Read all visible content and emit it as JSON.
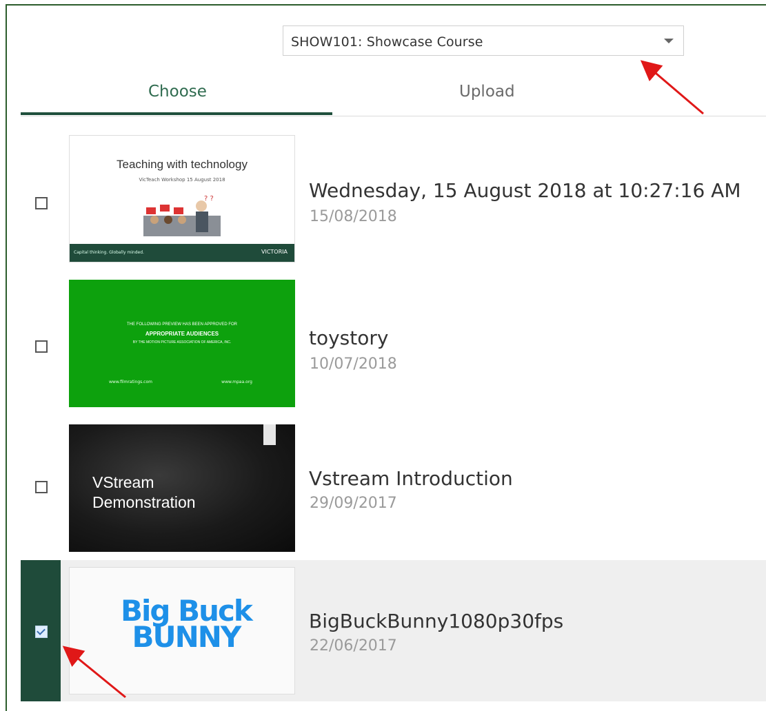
{
  "course_selector": {
    "value": "SHOW101: Showcase Course"
  },
  "tabs": [
    {
      "label": "Choose",
      "active": true
    },
    {
      "label": "Upload",
      "active": false
    }
  ],
  "colors": {
    "accent": "#1f4b3a",
    "thumb_green": "#0da10d"
  },
  "items": [
    {
      "title": "Wednesday, 15 August 2018 at 10:27:16 AM",
      "date": "15/08/2018",
      "checked": false,
      "thumb": {
        "heading": "Teaching with technology",
        "subheading": "VicTeach Workshop 15 August 2018",
        "footer_left": "Capital thinking. Globally minded.",
        "footer_right": "VICTORIA"
      }
    },
    {
      "title": "toystory",
      "date": "10/07/2018",
      "checked": false,
      "thumb": {
        "line1": "THE FOLLOWING PREVIEW HAS BEEN APPROVED FOR",
        "line2": "APPROPRIATE AUDIENCES",
        "line3": "BY THE MOTION PICTURE ASSOCIATION OF AMERICA, INC.",
        "footer_left": "www.filmratings.com",
        "footer_right": "www.mpaa.org"
      }
    },
    {
      "title": "Vstream Introduction",
      "date": "29/09/2017",
      "checked": false,
      "thumb": {
        "line1": "VStream",
        "line2": "Demonstration"
      }
    },
    {
      "title": "BigBuckBunny1080p30fps",
      "date": "22/06/2017",
      "checked": true,
      "thumb": {
        "logo_line1": "Big Buck",
        "logo_line2": "BUNNY"
      }
    }
  ]
}
